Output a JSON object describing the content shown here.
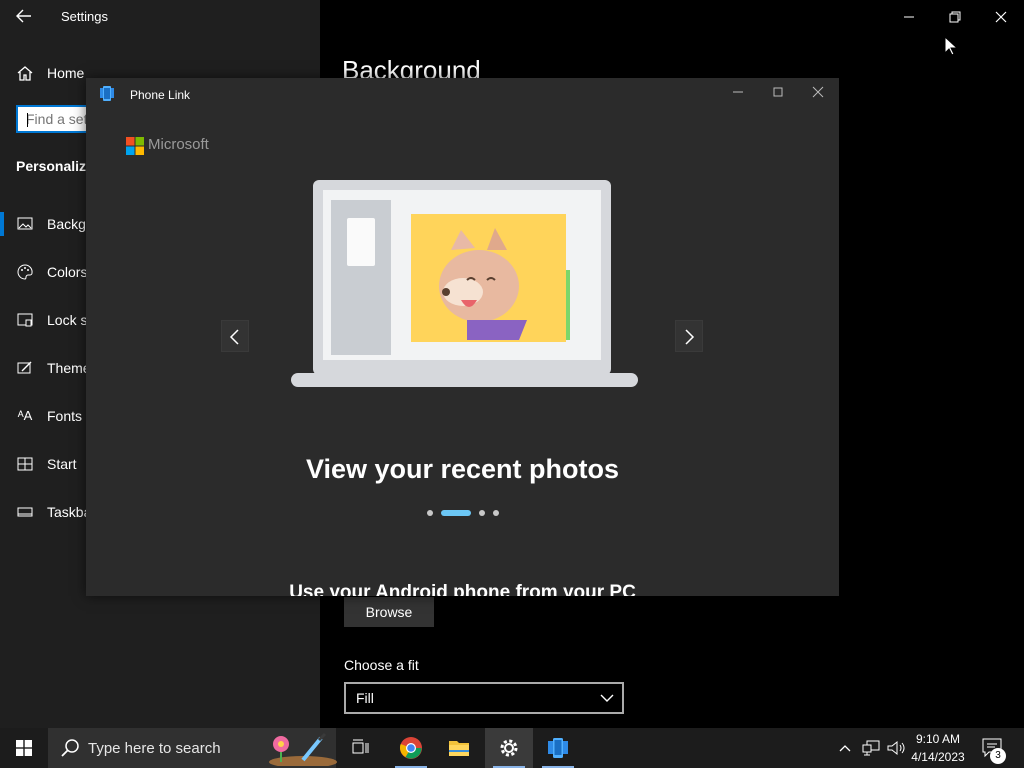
{
  "settings": {
    "title": "Settings",
    "home_label": "Home",
    "search_placeholder": "Find a setting",
    "section_heading": "Personalization",
    "nav_items": [
      {
        "label": "Background",
        "icon": "image-icon"
      },
      {
        "label": "Colors",
        "icon": "palette-icon"
      },
      {
        "label": "Lock screen",
        "icon": "lock-screen-icon"
      },
      {
        "label": "Themes",
        "icon": "themes-icon"
      },
      {
        "label": "Fonts",
        "icon": "fonts-icon"
      },
      {
        "label": "Start",
        "icon": "start-icon"
      },
      {
        "label": "Taskbar",
        "icon": "taskbar-icon"
      }
    ],
    "page_heading": "Background",
    "browse_label": "Browse",
    "choose_fit_label": "Choose a fit",
    "fit_value": "Fill"
  },
  "phone_link": {
    "title": "Phone Link",
    "brand": "Microsoft",
    "slide_title": "View your recent photos",
    "subheading": "Use your Android phone from your PC",
    "carousel": {
      "count": 4,
      "active_index": 1
    }
  },
  "taskbar": {
    "search_placeholder": "Type here to search",
    "apps": [
      "task-view",
      "chrome",
      "file-explorer",
      "settings",
      "phone-link"
    ],
    "time": "9:10 AM",
    "date": "4/14/2023",
    "notification_count": "3"
  },
  "colors": {
    "accent": "#0078d4",
    "carousel_active": "#6cc7f5",
    "sidebar_bg": "#1f1f1f",
    "window_bg": "#2b2b2b"
  }
}
